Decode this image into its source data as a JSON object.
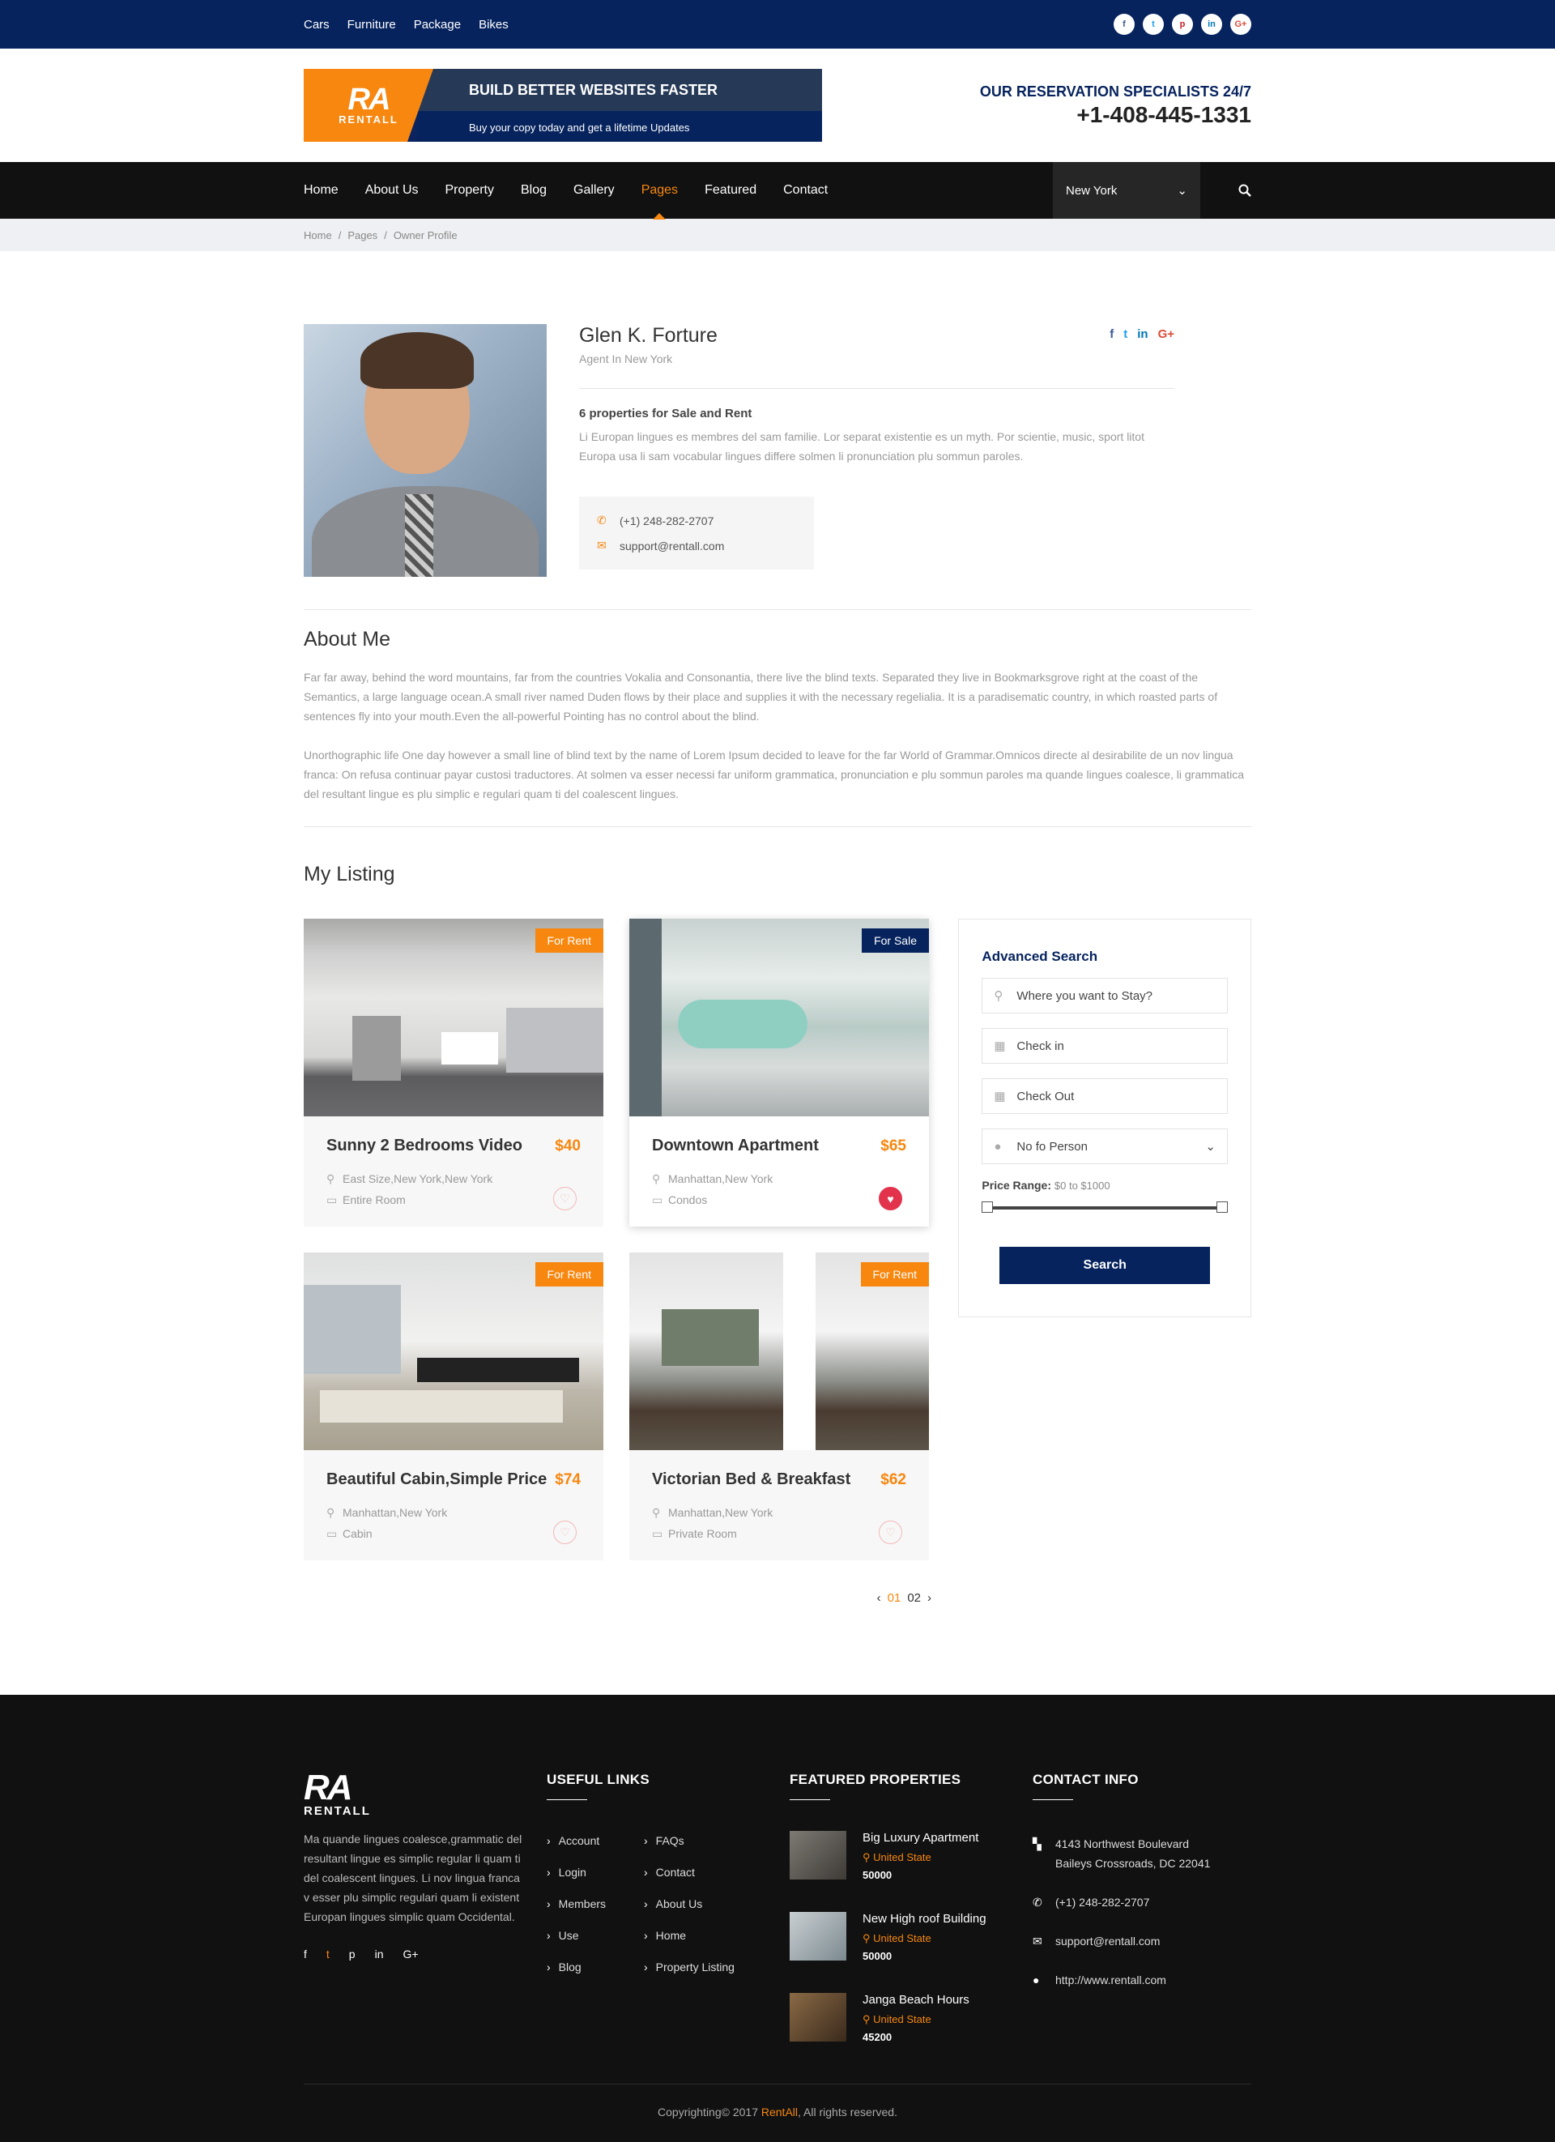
{
  "topbar": {
    "links": [
      "Cars",
      "Furniture",
      "Package",
      "Bikes"
    ],
    "social": [
      "f",
      "t",
      "p",
      "in",
      "G+"
    ]
  },
  "header": {
    "logo_mark": "RA",
    "logo_name": "RENTALL",
    "banner_title": "BUILD BETTER WEBSITES FASTER",
    "banner_sub": "Buy your copy today and get a lifetime Updates",
    "reserv_label": "OUR RESERVATION SPECIALISTS 24/7",
    "reserv_phone": "+1-408-445-1331"
  },
  "nav": {
    "items": [
      "Home",
      "About Us",
      "Property",
      "Blog",
      "Gallery",
      "Pages",
      "Featured",
      "Contact"
    ],
    "active": "Pages",
    "city": "New York"
  },
  "breadcrumb": [
    "Home",
    "Pages",
    "Owner Profile"
  ],
  "profile": {
    "name": "Glen K. Forture",
    "role": "Agent In New York",
    "count": "6 properties for Sale and Rent",
    "desc": "Li Europan lingues es membres del sam familie. Lor separat existentie es un myth. Por scientie, music, sport litot Europa usa li sam vocabular lingues differe solmen li pronunciation plu sommun paroles.",
    "phone": "(+1) 248-282-2707",
    "email": "support@rentall.com",
    "social": [
      "f",
      "t",
      "in",
      "G+"
    ]
  },
  "about": {
    "title": "About Me",
    "p1": "Far far away, behind the word mountains, far from the countries Vokalia and Consonantia, there live the blind texts. Separated they live in Bookmarksgrove right at the coast of the Semantics, a large language ocean.A small river named Duden flows by their place and supplies it with the necessary regelialia. It is a paradisematic country, in which roasted parts of sentences fly into your mouth.Even the all-powerful Pointing has no control about the blind.",
    "p2": "Unorthographic life One day however a small line of blind text by the name of Lorem Ipsum decided to leave for the far World of Grammar.Omnicos directe al desirabilite de un nov lingua franca: On refusa continuar payar custosi traductores. At solmen va esser necessi far uniform grammatica, pronunciation e plu sommun paroles ma quande lingues coalesce, li grammatica del resultant lingue es plu simplic e regulari quam ti del coalescent lingues."
  },
  "listing": {
    "title": "My Listing",
    "cards": [
      {
        "name": "Sunny 2 Bedrooms Video",
        "price": "$40",
        "tag": "For Rent",
        "location": "East Size,New York,New York",
        "type": "Entire Room"
      },
      {
        "name": "Downtown Apartment",
        "price": "$65",
        "tag": "For Sale",
        "location": "Manhattan,New York",
        "type": "Condos"
      },
      {
        "name": "Beautiful Cabin,Simple Price",
        "price": "$74",
        "tag": "For Rent",
        "location": "Manhattan,New York",
        "type": "Cabin"
      },
      {
        "name": "Victorian Bed & Breakfast",
        "price": "$62",
        "tag": "For Rent",
        "location": "Manhattan,New York",
        "type": "Private Room"
      }
    ],
    "pager": [
      "‹",
      "01",
      "02",
      "›"
    ]
  },
  "search": {
    "title": "Advanced Search",
    "where_placeholder": "Where you want to Stay?",
    "checkin_placeholder": "Check in",
    "checkout_placeholder": "Check Out",
    "person": "No fo Person",
    "price_label": "Price Range:",
    "price_value": "$0 to $1000",
    "price_min": 0,
    "price_max": 1000,
    "button": "Search"
  },
  "footer": {
    "logo_mark": "RA",
    "logo_name": "RENTALL",
    "about": "Ma quande lingues coalesce,grammatic del resultant lingue es simplic regular li quam ti del coalescent lingues. Li nov lingua franca v esser plu simplic regulari quam li existent Europan lingues simplic quam Occidental.",
    "social": [
      "f",
      "t",
      "p",
      "in",
      "G+"
    ],
    "links_title": "USEFUL LINKS",
    "links": [
      "Account",
      "FAQs",
      "Login",
      "Contact",
      "Members",
      "About Us",
      "Use",
      "Home",
      "Blog",
      "Property Listing"
    ],
    "featured_title": "FEATURED PROPERTIES",
    "featured": [
      {
        "name": "Big Luxury Apartment",
        "loc": "United State",
        "price": "50000"
      },
      {
        "name": "New High roof Building",
        "loc": "United State",
        "price": "50000"
      },
      {
        "name": "Janga Beach Hours",
        "loc": "United State",
        "price": "45200"
      }
    ],
    "contact_title": "CONTACT INFO",
    "address1": "4143 Northwest Boulevard",
    "address2": "Baileys Crossroads, DC 22041",
    "phone": "(+1) 248-282-2707",
    "email": "support@rentall.com",
    "web": "http://www.rentall.com",
    "copy_pre": "Copyrighting© 2017 ",
    "copy_brand": "RentAll",
    "copy_post": ", All rights reserved."
  },
  "colors": {
    "accent": "#f7870f",
    "navy": "#06235e",
    "dark": "#111111"
  }
}
